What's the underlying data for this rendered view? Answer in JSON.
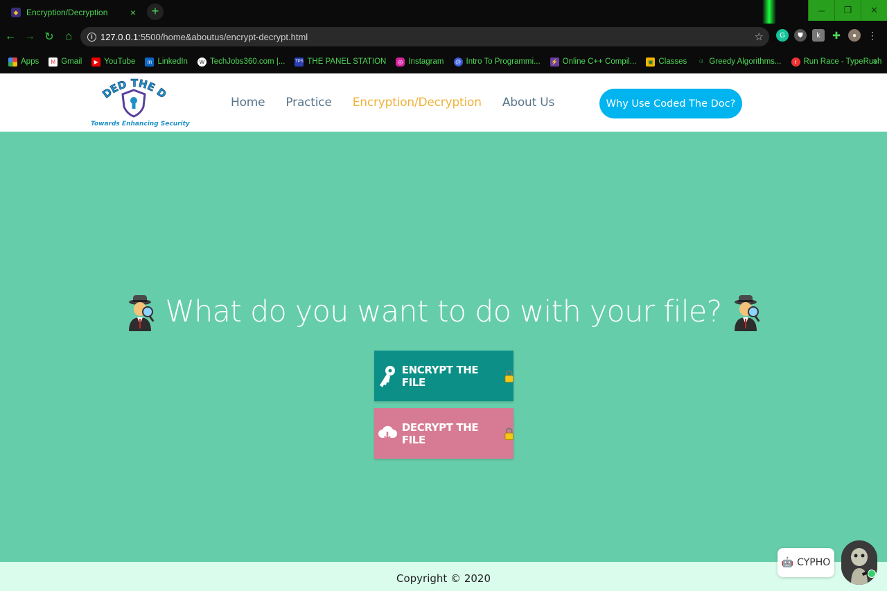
{
  "browser": {
    "tab_title": "Encryption/Decryption",
    "tab_close": "×",
    "new_tab": "+",
    "url_host": "127.0.0.1",
    "url_rest": ":5500/home&aboutus/encrypt-decrypt.html",
    "window_controls": [
      "─",
      "❐",
      "✕"
    ],
    "bookmarks": [
      {
        "label": "Apps",
        "icon": "apps-grid-icon",
        "color": "#e44"
      },
      {
        "label": "Gmail",
        "icon": "gmail-icon",
        "color": "#d33"
      },
      {
        "label": "YouTube",
        "icon": "youtube-icon",
        "color": "#e00"
      },
      {
        "label": "LinkedIn",
        "icon": "linkedin-icon",
        "color": "#0a66c2"
      },
      {
        "label": "TechJobs360.com |...",
        "icon": "wordpress-icon",
        "color": "#555"
      },
      {
        "label": "THE PANEL STATION",
        "icon": "tps-icon",
        "color": "#2b3fb3"
      },
      {
        "label": "Instagram",
        "icon": "instagram-icon",
        "color": "#d6249f"
      },
      {
        "label": "Intro To Programmi...",
        "icon": "at-icon",
        "color": "#3b5bdb"
      },
      {
        "label": "Online C++ Compil...",
        "icon": "bolt-icon",
        "color": "#6b3fa0"
      },
      {
        "label": "Classes",
        "icon": "classroom-icon",
        "color": "#f4b400"
      },
      {
        "label": "Greedy Algorithms...",
        "icon": "gfg-icon",
        "color": "#2f8d46"
      },
      {
        "label": "Run Race - TypeRush",
        "icon": "typerush-icon",
        "color": "#e33"
      }
    ],
    "bookmarks_more": "»"
  },
  "site": {
    "logo_title": "CODED THE DOC",
    "logo_tagline": "Towards Enhancing Security",
    "nav": [
      {
        "label": "Home",
        "active": false
      },
      {
        "label": "Practice",
        "active": false
      },
      {
        "label": "Encryption/Decryption",
        "active": true
      },
      {
        "label": "About Us",
        "active": false
      }
    ],
    "cta_label": "Why Use Coded The Doc?"
  },
  "main": {
    "headline": "What do you want to do with your file?",
    "encrypt_label": "ENCRYPT THE FILE",
    "decrypt_label": "DECRYPT THE FILE"
  },
  "footer": {
    "copyright": "Copyright © 2020"
  },
  "chat": {
    "label": "CYPHO"
  },
  "colors": {
    "page_bg": "#66cdaa",
    "encrypt_bg": "#0b8f87",
    "decrypt_bg": "#d67b93",
    "cta_bg": "#00b4f0",
    "active_nav": "#f0b23a",
    "footer_bg": "#d9fcec"
  }
}
